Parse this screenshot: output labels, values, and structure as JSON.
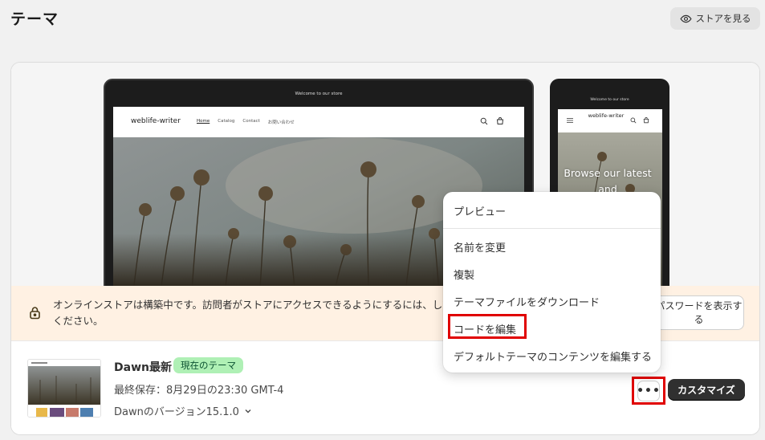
{
  "header": {
    "title": "テーマ",
    "view_store_label": "ストアを見る"
  },
  "preview": {
    "desktop": {
      "announcement": "Welcome to our store",
      "brand": "weblife-writer",
      "nav": [
        "Home",
        "Catalog",
        "Contact",
        "お問い合わせ"
      ]
    },
    "mobile": {
      "announcement": "Welcome to our store",
      "brand": "weblife-writer",
      "hero_text": "Browse our latest and"
    }
  },
  "banner": {
    "message": "オンラインストアは構築中です。訪問者がストアにアクセスできるようにするには、してください。",
    "button_label": "パスワードを表示する"
  },
  "theme": {
    "name": "Dawn最新",
    "badge": "現在のテーマ",
    "last_saved": "最終保存：8月29日の23:30 GMT-4",
    "version": "Dawnのバージョン15.1.0",
    "more_label": "•••",
    "customize_label": "カスタマイズ"
  },
  "menu": {
    "items": [
      "プレビュー",
      "名前を変更",
      "複製",
      "テーマファイルをダウンロード",
      "コードを編集",
      "デフォルトテーマのコンテンツを編集する"
    ]
  },
  "colors": {
    "badge_bg": "#aff0b5",
    "banner_bg": "#fff1e3",
    "highlight": "#e00000",
    "primary_button": "#303030"
  },
  "icons": {
    "view_store": "eye-icon",
    "banner": "lock-icon",
    "version": "chevron-down-icon",
    "search": "search-icon",
    "cart": "cart-icon",
    "menu": "hamburger-icon"
  }
}
